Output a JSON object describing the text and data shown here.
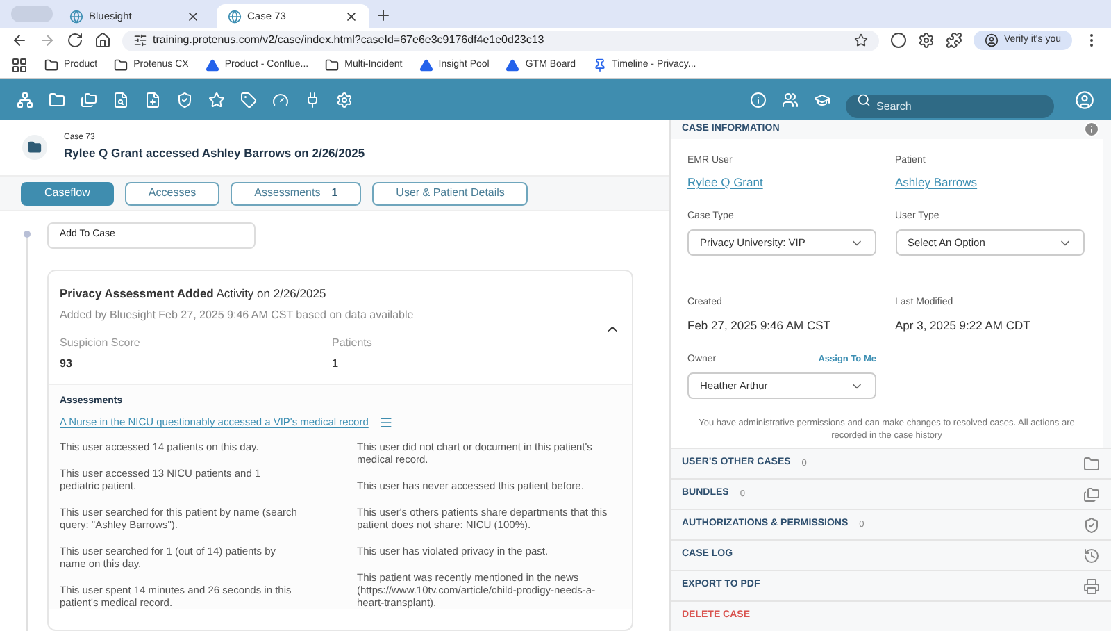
{
  "browser": {
    "tabs": [
      {
        "title": "Bluesight",
        "selected": false
      },
      {
        "title": "Case 73",
        "selected": true
      }
    ],
    "url": "training.protenus.com/v2/case/index.html?caseId=67e6e3c9176df4e1e0d23c13",
    "profile_button": "Verify it's you",
    "bookmarks": [
      {
        "label": "Product",
        "kind": "folder"
      },
      {
        "label": "Protenus CX",
        "kind": "folder"
      },
      {
        "label": "Product - Conflue...",
        "kind": "app"
      },
      {
        "label": "Multi-Incident",
        "kind": "folder"
      },
      {
        "label": "Insight Pool",
        "kind": "app"
      },
      {
        "label": "GTM Board",
        "kind": "app"
      },
      {
        "label": "Timeline - Privacy...",
        "kind": "pin"
      }
    ]
  },
  "search": {
    "placeholder": "Search"
  },
  "case": {
    "label": "Case 73",
    "title": "Rylee Q Grant accessed Ashley Barrows on 2/26/2025"
  },
  "view_tabs": [
    {
      "label": "Caseflow",
      "selected": true
    },
    {
      "label": "Accesses",
      "selected": false
    },
    {
      "label": "Assessments",
      "count": "1",
      "selected": false
    },
    {
      "label": "User & Patient Details",
      "selected": false
    }
  ],
  "add_to_case": "Add To Case",
  "activity": {
    "title": "**Privacy Assessment Added** Activity on 2/26/2025",
    "subtitle": "Added by Bluesight Feb 27, 2025 9:46 AM CST based on data available",
    "expanded": true,
    "stats": [
      {
        "label": "Suspicion Score",
        "value": "93"
      },
      {
        "label": "Patients",
        "value": "1"
      }
    ],
    "assessments_heading": "Assessments",
    "assessment_link": "A Nurse in the NICU questionably accessed a VIP's medical record",
    "findings_left": [
      "This user accessed 14 patients on this day.",
      "This user accessed 13 NICU patients and 1 pediatric patient.",
      "This user searched for this patient by name (search query: \"Ashley Barrows\").",
      "This user searched for 1 (out of 14) patients by name on this day.",
      "This user spent 14 minutes and 26 seconds in this patient's medical record."
    ],
    "findings_right": [
      "This user did not chart or document in this patient's medical record.",
      "This user has never accessed this patient before.",
      "This user's others patients share departments that this patient does not share: NICU (100%).",
      "This user has violated privacy in the past.",
      "This patient was recently mentioned in the news (https://www.10tv.com/article/child-prodigy-needs-a-heart-transplant)."
    ]
  },
  "case_info": {
    "title": "CASE INFORMATION",
    "emr_user": {
      "label": "EMR User",
      "value": "Rylee Q Grant"
    },
    "patient": {
      "label": "Patient",
      "value": "Ashley Barrows"
    },
    "case_type": {
      "label": "Case Type",
      "value": "Privacy University: VIP"
    },
    "user_type": {
      "label": "User Type",
      "value": "Select An Option"
    },
    "created": {
      "label": "Created",
      "value": "Feb 27, 2025 9:46 AM CST"
    },
    "last_modified": {
      "label": "Last Modified",
      "value": "Apr 3, 2025 9:22 AM CDT"
    },
    "owner": {
      "label": "Owner",
      "action": "Assign To Me",
      "value": "Heather Arthur"
    },
    "notice": "You have administrative permissions and can make changes to resolved cases. All actions are recorded in the case history"
  },
  "sections": [
    {
      "title": "USER'S OTHER CASES",
      "count": "0",
      "kind": "folder"
    },
    {
      "title": "BUNDLES",
      "count": "0",
      "kind": "folders"
    },
    {
      "title": "AUTHORIZATIONS & PERMISSIONS",
      "count": "0",
      "kind": "shield"
    },
    {
      "title": "CASE LOG",
      "kind": "history"
    },
    {
      "title": "EXPORT TO PDF",
      "kind": "export"
    },
    {
      "title": "DELETE CASE",
      "kind": "danger"
    }
  ]
}
